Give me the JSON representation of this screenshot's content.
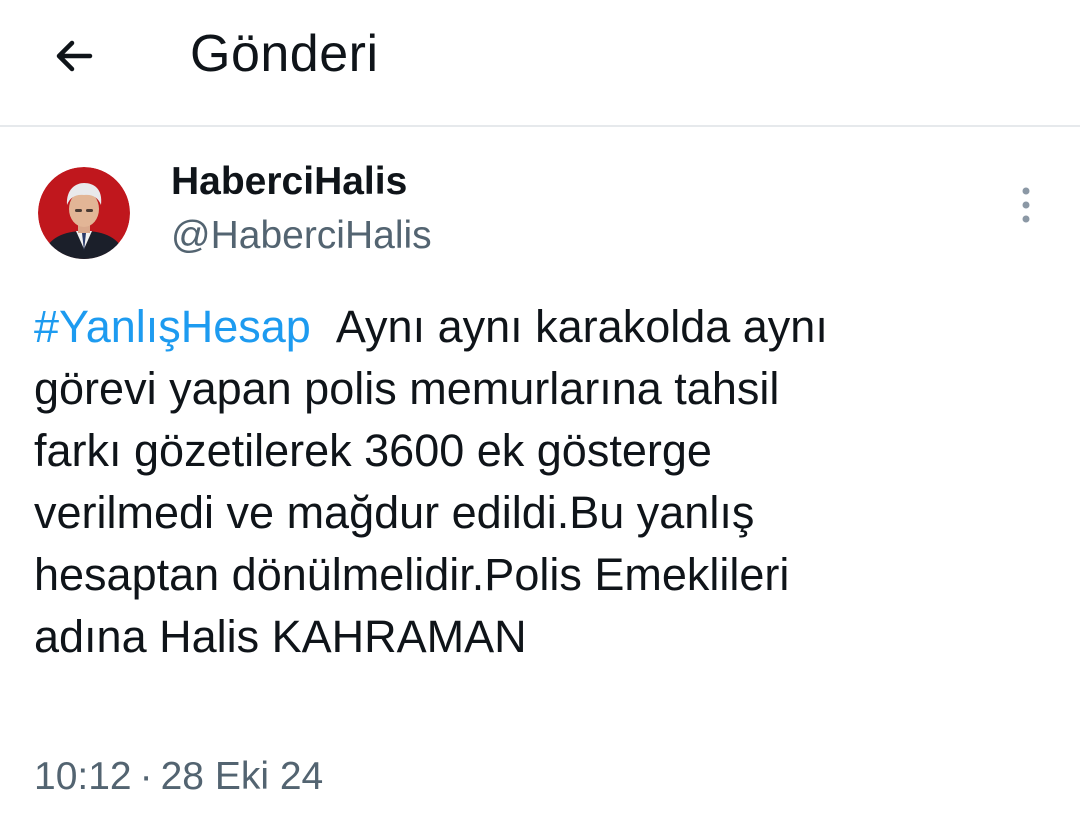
{
  "header": {
    "title": "Gönderi",
    "back_icon": "arrow-left-icon"
  },
  "tweet": {
    "display_name": "HaberciHalis",
    "handle": "@HaberciHalis",
    "more_icon": "more-vertical-icon",
    "hashtag": "#YanlışHesap",
    "body_lines": [
      "Aynı aynı karakolda aynı",
      "görevi yapan polis memurlarına tahsil",
      "farkı gözetilerek 3600 ek gösterge",
      "verilmedi ve mağdur edildi.Bu yanlış",
      "hesaptan dönülmelidir.Polis Emeklileri",
      "adına Halis KAHRAMAN"
    ],
    "time": "10:12",
    "separator": "·",
    "date": "28 Eki 24"
  },
  "colors": {
    "link": "#1d9bf0",
    "secondary_text": "#536471",
    "divider": "#e6e9ec",
    "avatar_background": "#c0171d"
  }
}
